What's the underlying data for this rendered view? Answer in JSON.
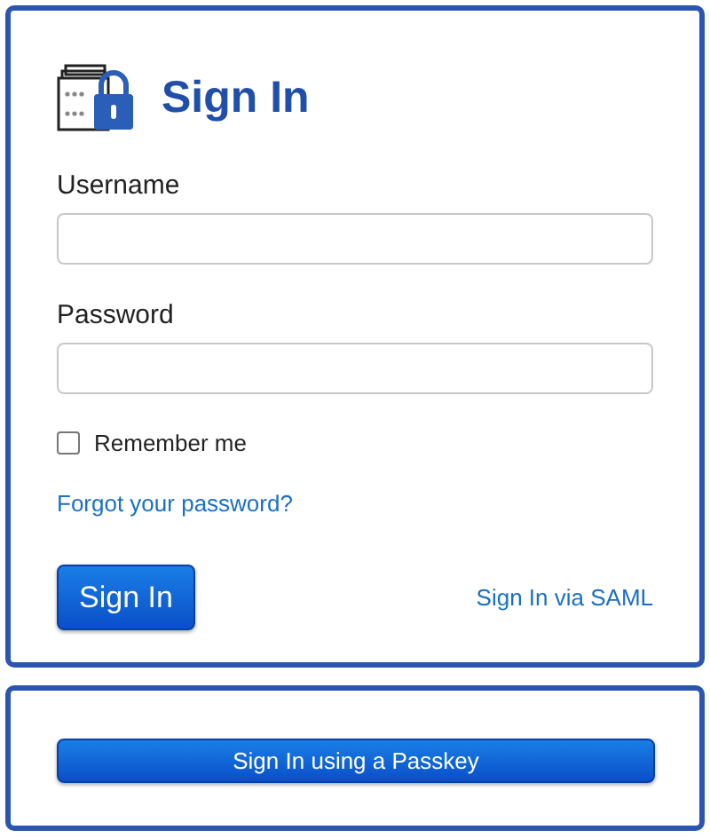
{
  "title": "Sign In",
  "fields": [
    {
      "label": "Username"
    },
    {
      "label": "Password"
    }
  ],
  "remember": {
    "label": "Remember me",
    "checked": false
  },
  "forgot_link": "Forgot your password?",
  "submit_button": "Sign In",
  "saml_link": "Sign In via SAML",
  "passkey_button": "Sign In using a Passkey"
}
